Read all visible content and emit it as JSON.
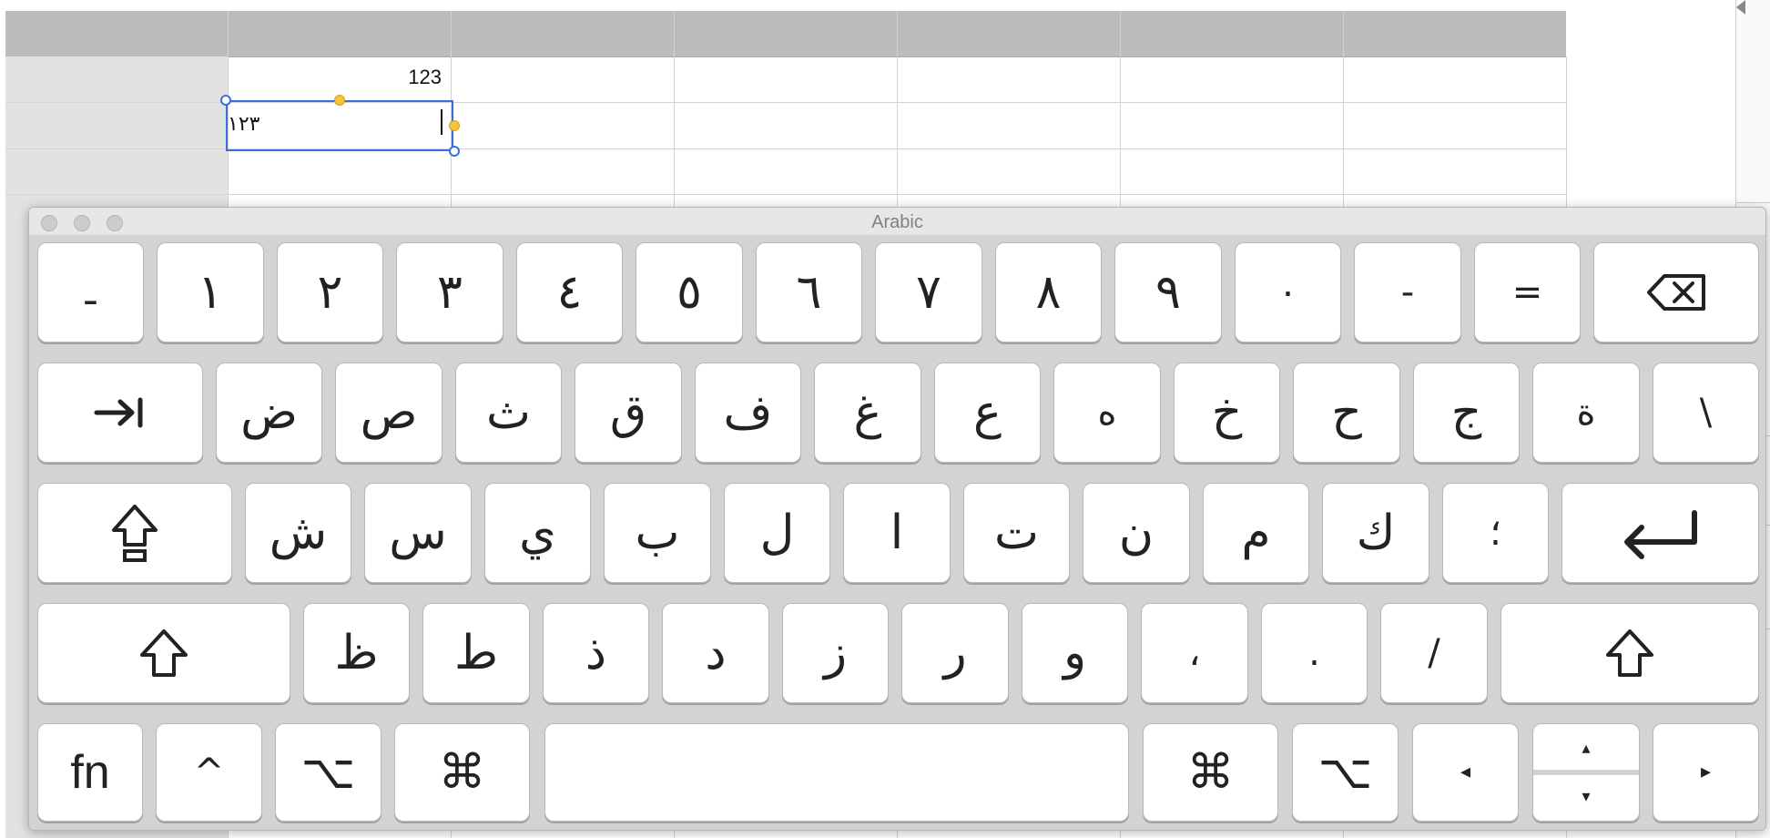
{
  "sheet": {
    "cells": {
      "a1": "123",
      "a2": "١٢٣"
    }
  },
  "keyboard_viewer": {
    "title": "Arabic",
    "rows": [
      [
        "ـ",
        "١",
        "٢",
        "٣",
        "٤",
        "٥",
        "٦",
        "٧",
        "٨",
        "٩",
        "٠",
        "-",
        "=",
        "delete-icon"
      ],
      [
        "tab-icon",
        "ض",
        "ص",
        "ث",
        "ق",
        "ف",
        "غ",
        "ع",
        "ه",
        "خ",
        "ح",
        "ج",
        "ة",
        "\\"
      ],
      [
        "caps-lock-icon",
        "ش",
        "س",
        "ي",
        "ب",
        "ل",
        "ا",
        "ت",
        "ن",
        "م",
        "ك",
        "؛",
        "return-icon"
      ],
      [
        "shift-icon",
        "ظ",
        "ط",
        "ذ",
        "د",
        "ز",
        "ر",
        "و",
        "،",
        ".",
        "/",
        "shift-icon"
      ],
      [
        "fn",
        "^",
        "⌥",
        "⌘",
        "",
        "⌘",
        "⌥",
        "◂",
        "▴",
        "▾",
        "▸"
      ]
    ],
    "keys": {
      "r1": [
        "ـ",
        "١",
        "٢",
        "٣",
        "٤",
        "٥",
        "٦",
        "٧",
        "٨",
        "٩",
        "٠",
        "-",
        "="
      ],
      "r2": [
        "ض",
        "ص",
        "ث",
        "ق",
        "ف",
        "غ",
        "ع",
        "ه",
        "خ",
        "ح",
        "ج",
        "ة",
        "\\"
      ],
      "r3": [
        "ش",
        "س",
        "ي",
        "ب",
        "ل",
        "ا",
        "ت",
        "ن",
        "م",
        "ك",
        "؛"
      ],
      "r4": [
        "ظ",
        "ط",
        "ذ",
        "د",
        "ز",
        "ر",
        "و",
        "،",
        ".",
        "/"
      ],
      "r5": {
        "fn": "fn",
        "control": "^",
        "option_left": "⌥",
        "command_left": "⌘",
        "command_right": "⌘",
        "option_right": "⌥",
        "arrow_left": "◂",
        "arrow_up": "▴",
        "arrow_down": "▾",
        "arrow_right": "▸"
      }
    }
  }
}
